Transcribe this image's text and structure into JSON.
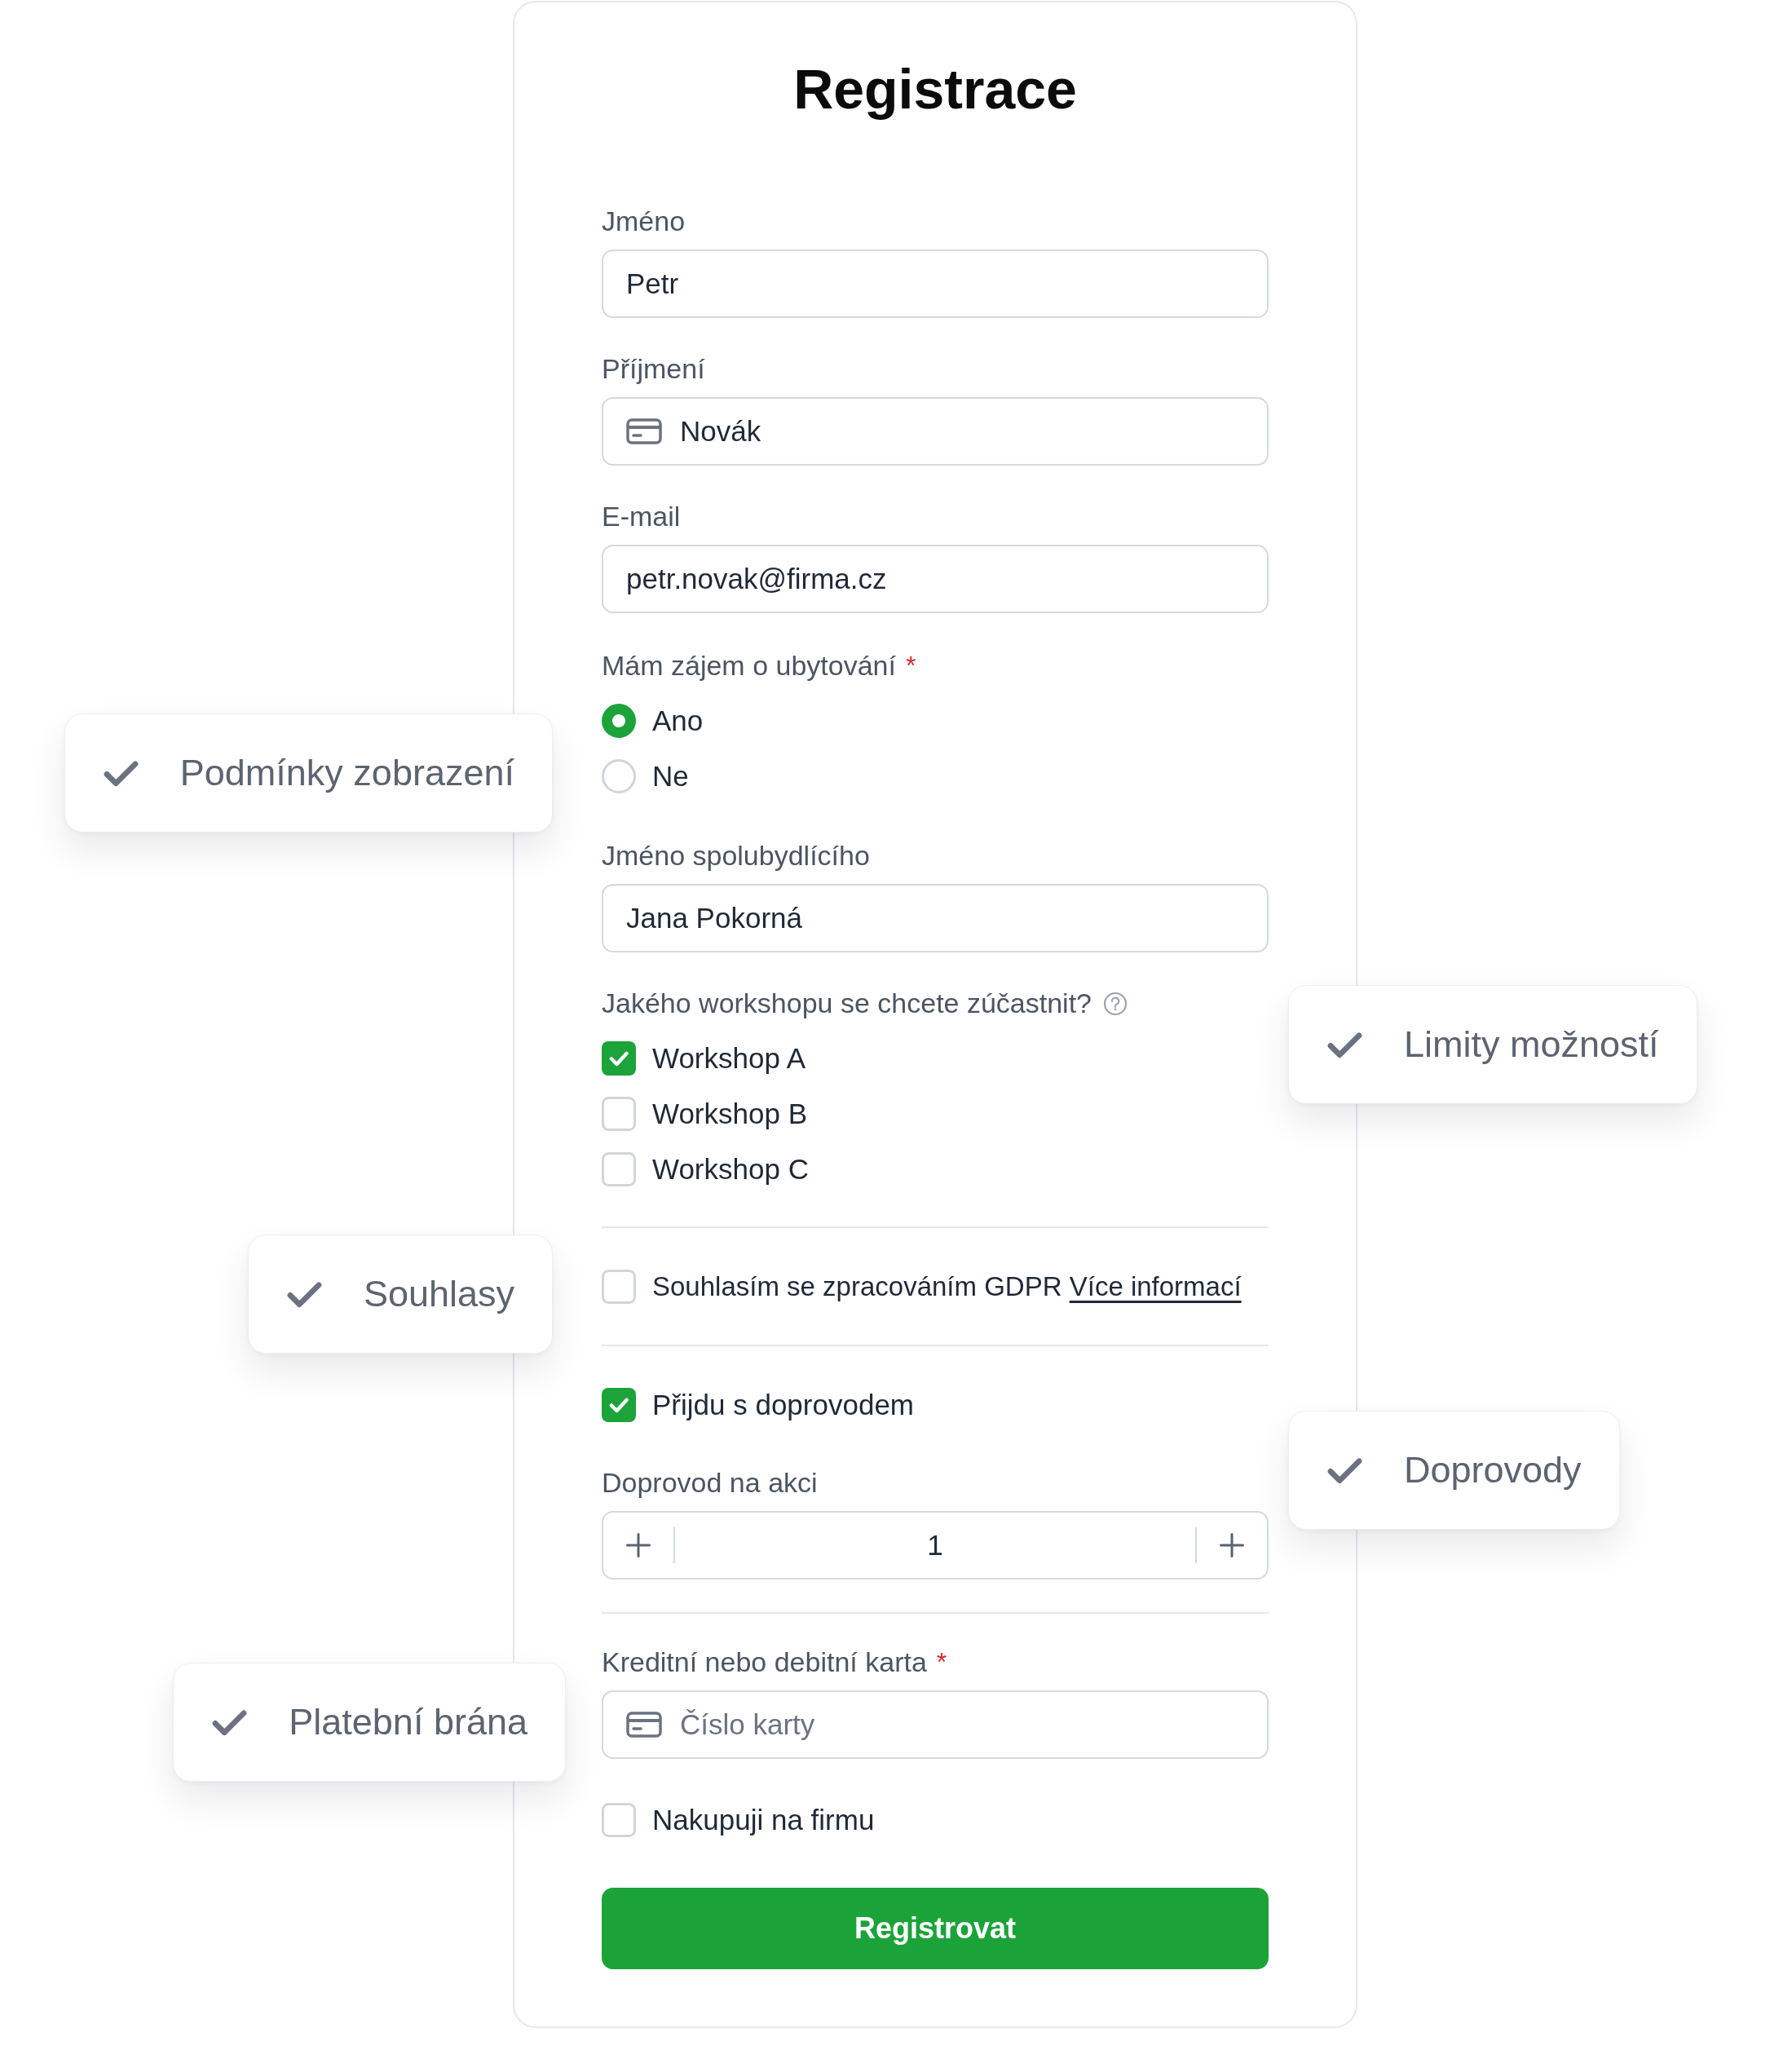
{
  "form": {
    "title": "Registrace",
    "items": [
      {
        "kind": "input",
        "label": "Jméno",
        "value": "Petr",
        "leading_icon": false
      },
      {
        "kind": "input",
        "label": "Příjmení",
        "value": "Novák",
        "leading_icon": true
      },
      {
        "kind": "input",
        "label": "E-mail",
        "value": "petr.novak@firma.cz",
        "leading_icon": false
      },
      {
        "kind": "radio-group",
        "label": "Mám zájem o ubytování",
        "required_mark": "*",
        "options": [
          {
            "label": "Ano",
            "selected": true
          },
          {
            "label": "Ne",
            "selected": false
          }
        ]
      },
      {
        "kind": "input",
        "label": "Jméno spolubydlícího",
        "value": "Jana Pokorná",
        "leading_icon": false
      },
      {
        "kind": "checkbox-group",
        "label": "Jakého workshopu se chcete zúčastnit?",
        "help": true,
        "options": [
          {
            "label": "Workshop A",
            "checked": true
          },
          {
            "label": "Workshop B",
            "checked": false
          },
          {
            "label": "Workshop C",
            "checked": false
          }
        ]
      },
      {
        "kind": "divider"
      },
      {
        "kind": "checkbox",
        "label": "Souhlasím se zpracováním GDPR",
        "link": "Více informací",
        "checked": false
      },
      {
        "kind": "divider"
      },
      {
        "kind": "checkbox",
        "label": "Přijdu s doprovodem",
        "checked": true
      },
      {
        "kind": "stepper",
        "label": "Doprovod na akci",
        "value": "1"
      },
      {
        "kind": "divider"
      },
      {
        "kind": "input",
        "label": "Kreditní nebo debitní karta",
        "required_mark": "*",
        "placeholder": "Číslo karty",
        "leading_icon": true
      },
      {
        "kind": "checkbox",
        "label": "Nakupuji na firmu",
        "checked": false
      },
      {
        "kind": "button",
        "label": "Registrovat"
      }
    ]
  },
  "callouts": [
    {
      "label": "Podmínky zobrazení"
    },
    {
      "label": "Limity možností"
    },
    {
      "label": "Souhlasy"
    },
    {
      "label": "Doprovody"
    },
    {
      "label": "Platební brána"
    }
  ]
}
